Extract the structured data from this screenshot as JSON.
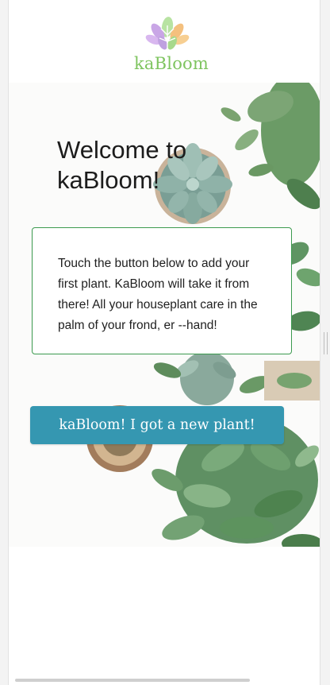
{
  "app": {
    "logo_text": "kaBloom",
    "logo_icon": "leaf-flower-logo"
  },
  "hero": {
    "title": "Welcome to kaBloom!",
    "intro": "Touch the button below to add your first plant. KaBloom will take it from there! All your houseplant care in the palm of your frond, er --hand!",
    "cta_label": "kaBloom! I got a new plant!"
  },
  "colors": {
    "logo_green": "#7ec45f",
    "card_border": "#3c9a4f",
    "button": "#3597b1"
  }
}
